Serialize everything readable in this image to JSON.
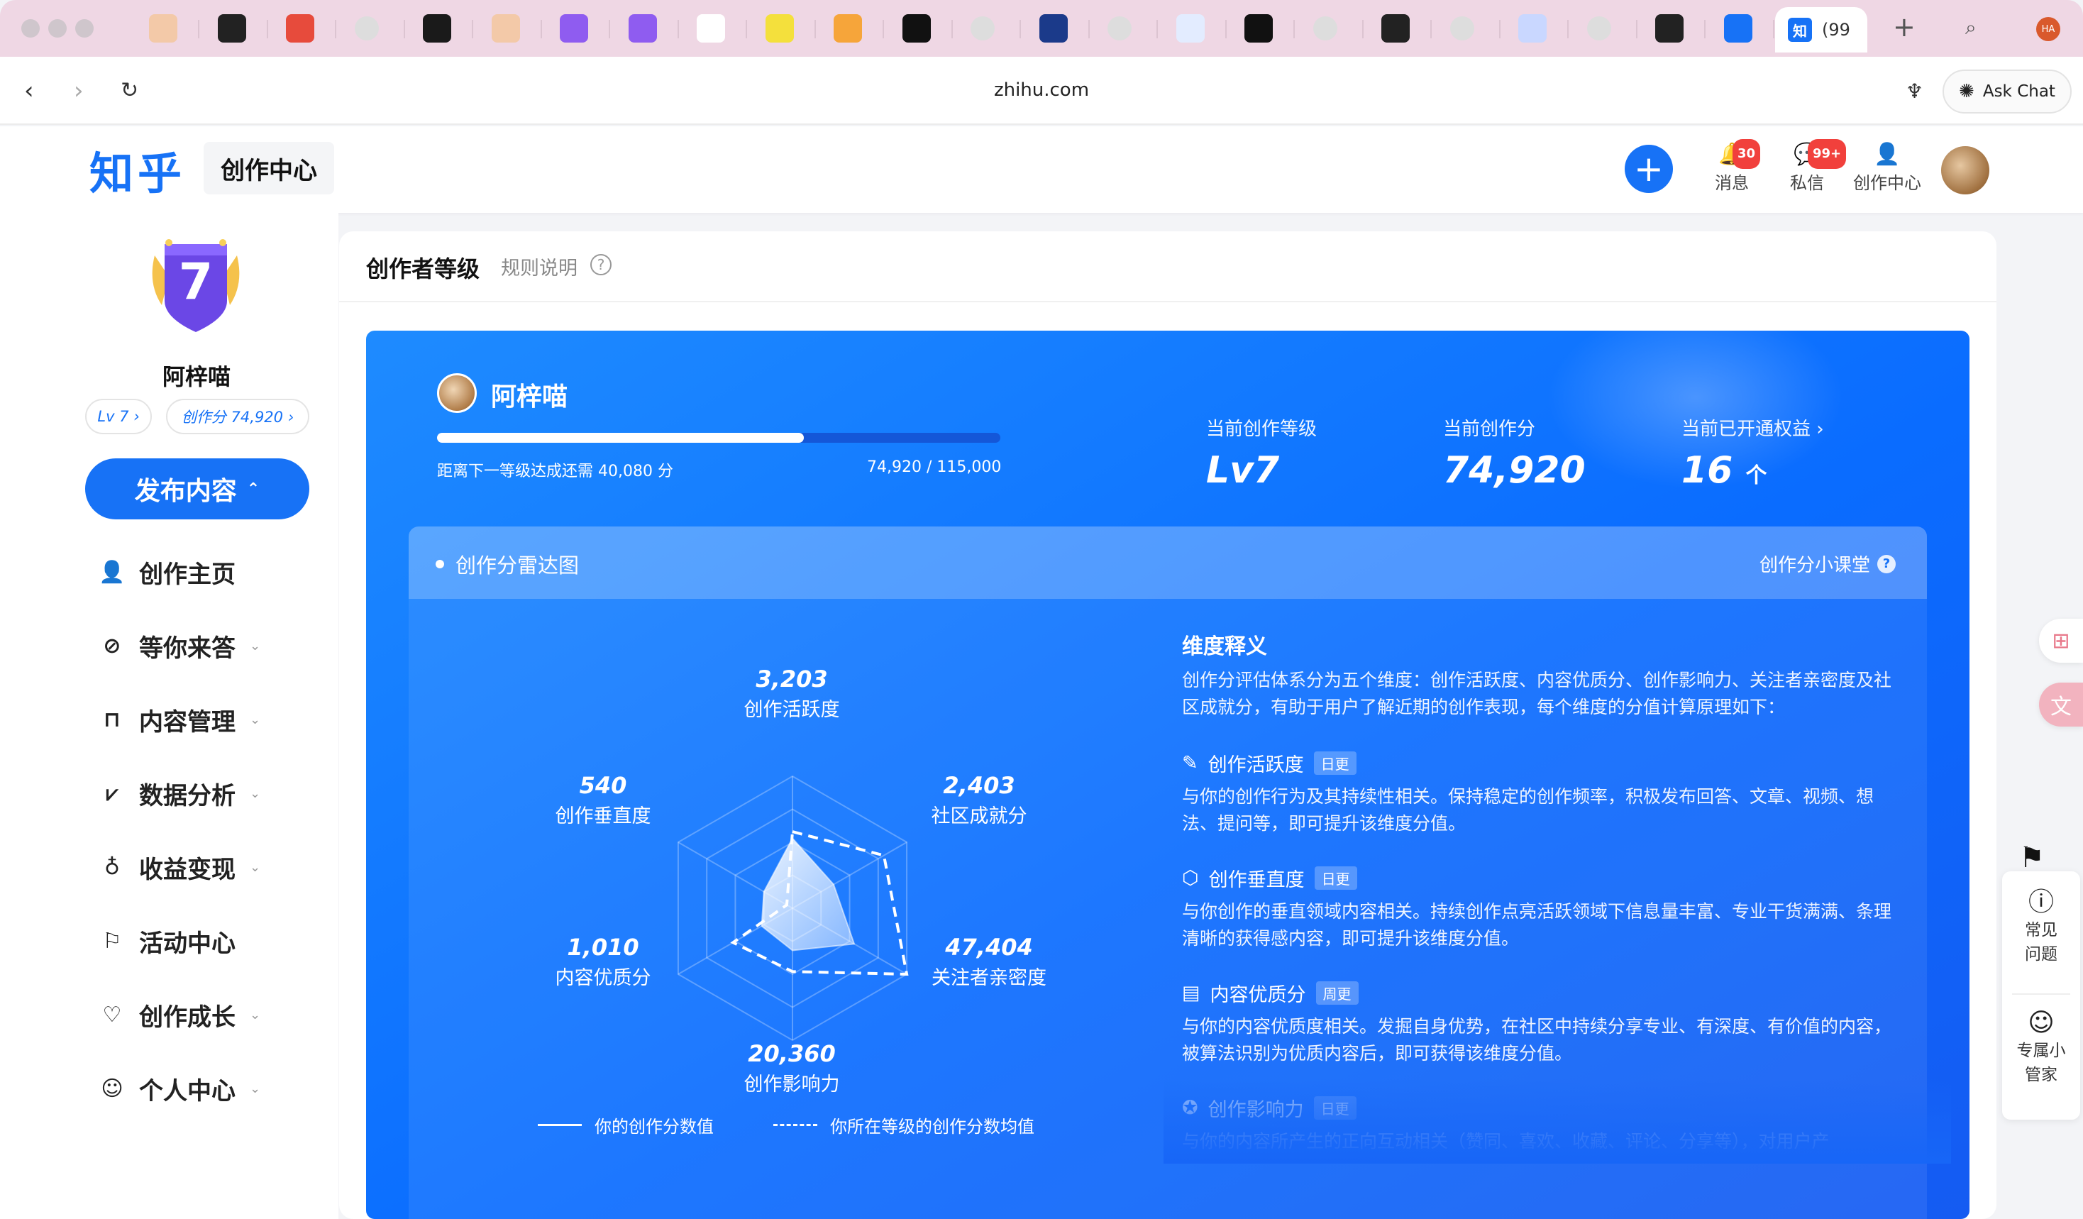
{
  "browser": {
    "url": "zhihu.com",
    "active_tab_icon": "知",
    "active_tab_title": "(99",
    "ask_chat_label": "Ask Chat",
    "profile_badge": "HA"
  },
  "header": {
    "logo": "知乎",
    "hub_label": "创作中心",
    "items": [
      {
        "label": "消息",
        "badge": "30",
        "icon": "bell-icon"
      },
      {
        "label": "私信",
        "badge": "99+",
        "icon": "chat-icon"
      },
      {
        "label": "创作中心",
        "badge": "",
        "icon": "creator-icon"
      }
    ]
  },
  "sidebar": {
    "level_number": "7",
    "username": "阿梓喵",
    "level_pill": "Lv 7 ›",
    "score_pill": "创作分 74,920 ›",
    "publish_label": "发布内容",
    "items": [
      {
        "label": "创作主页",
        "icon": "person-icon",
        "chevron": false
      },
      {
        "label": "等你来答",
        "icon": "compass-icon",
        "chevron": true
      },
      {
        "label": "内容管理",
        "icon": "cup-icon",
        "chevron": true
      },
      {
        "label": "数据分析",
        "icon": "chart-icon",
        "chevron": true
      },
      {
        "label": "收益变现",
        "icon": "moneybag-icon",
        "chevron": true
      },
      {
        "label": "活动中心",
        "icon": "flag-icon",
        "chevron": false
      },
      {
        "label": "创作成长",
        "icon": "heart-icon",
        "chevron": true
      },
      {
        "label": "个人中心",
        "icon": "user-circle-icon",
        "chevron": true
      }
    ]
  },
  "main": {
    "title": "创作者等级",
    "rules_label": "规则说明",
    "profile_name": "阿梓喵",
    "progress": 0.6515,
    "progress_left": "距离下一等级达成还需 40,080 分",
    "progress_right": "74,920 / 115,000",
    "stats": [
      {
        "label": "当前创作等级",
        "value": "Lv7",
        "unit": ""
      },
      {
        "label": "当前创作分",
        "value": "74,920",
        "unit": ""
      },
      {
        "label": "当前已开通权益 ›",
        "value": "16",
        "unit": "个"
      }
    ],
    "radar_title": "创作分雷达图",
    "lesson_label": "创作分小课堂",
    "radar_labels": [
      {
        "value": "3,203",
        "name": "创作活跃度"
      },
      {
        "value": "2,403",
        "name": "社区成就分"
      },
      {
        "value": "47,404",
        "name": "关注者亲密度"
      },
      {
        "value": "20,360",
        "name": "创作影响力"
      },
      {
        "value": "1,010",
        "name": "内容优质分"
      },
      {
        "value": "540",
        "name": "创作垂直度"
      }
    ],
    "legend_user": "你的创作分数值",
    "legend_avg": "你所在等级的创作分数均值",
    "dims_heading": "维度释义",
    "dims_intro": "创作分评估体系分为五个维度：创作活跃度、内容优质分、创作影响力、关注者亲密度及社区成就分，有助于用户了解近期的创作表现，每个维度的分值计算原理如下：",
    "dims": [
      {
        "title": "创作活跃度",
        "tag": "日更",
        "icon": "pen-icon",
        "desc": "与你的创作行为及其持续性相关。保持稳定的创作频率，积极发布回答、文章、视频、想法、提问等，即可提升该维度分值。"
      },
      {
        "title": "创作垂直度",
        "tag": "日更",
        "icon": "cube-icon",
        "desc": "与你创作的垂直领域内容相关。持续创作点亮活跃领域下信息量丰富、专业干货满满、条理清晰的获得感内容，即可提升该维度分值。"
      },
      {
        "title": "内容优质分",
        "tag": "周更",
        "icon": "article-icon",
        "desc": "与你的内容优质度相关。发掘自身优势，在社区中持续分享专业、有深度、有价值的内容，被算法识别为优质内容后，即可获得该维度分值。"
      },
      {
        "title": "创作影响力",
        "tag": "日更",
        "icon": "star-icon",
        "desc": "与你的内容所产生的正向互动相关（赞同、喜欢、收藏、评论、分享等），对用户产"
      }
    ]
  },
  "floating": {
    "faq_label": "常见问题",
    "butler_label": "专属小管家"
  }
}
